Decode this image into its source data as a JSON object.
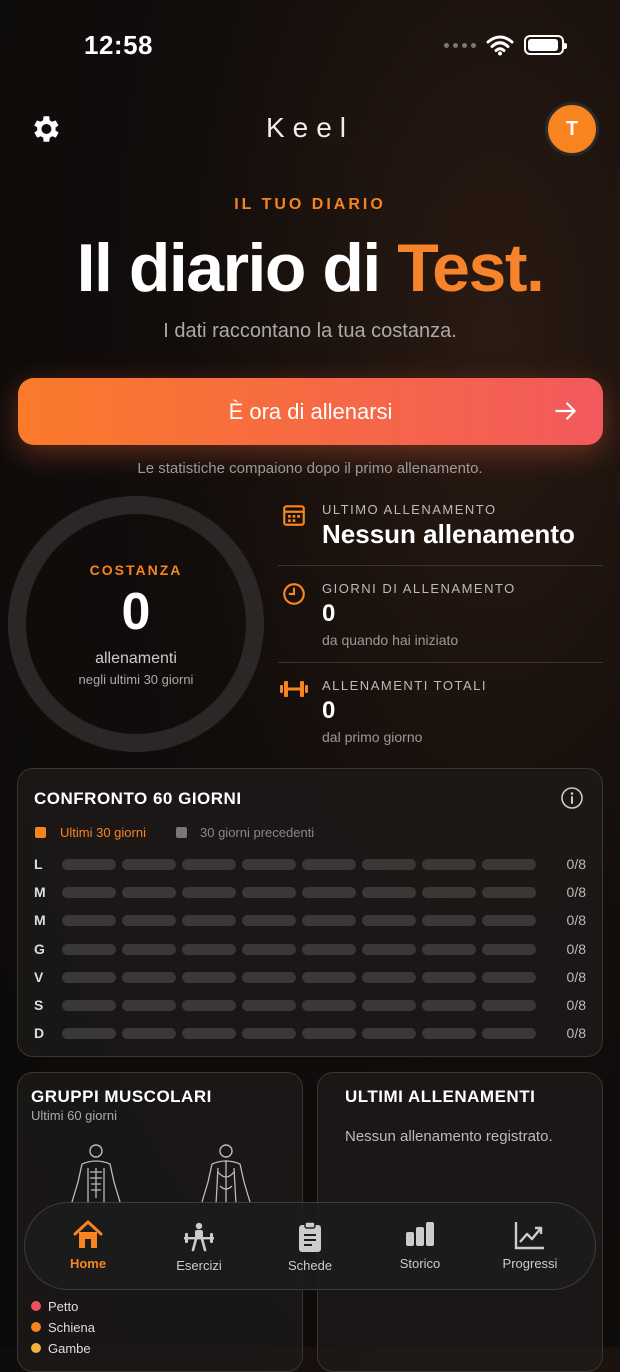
{
  "status": {
    "time": "12:58"
  },
  "header": {
    "brand": "Keel",
    "avatar_initial": "T"
  },
  "hero": {
    "kicker": "IL TUO DIARIO",
    "title_prefix": "Il diario di ",
    "title_accent": "Test.",
    "subtitle": "I dati raccontano la tua costanza."
  },
  "cta": {
    "label": "È ora di allenarsi"
  },
  "note": "Le statistiche compaiono dopo il primo allenamento.",
  "consistency": {
    "label": "COSTANZA",
    "value": "0",
    "unit": "allenamenti",
    "caption": "negli ultimi 30 giorni"
  },
  "stats": [
    {
      "label": "ULTIMO ALLENAMENTO",
      "value": "Nessun allenamento",
      "caption": ""
    },
    {
      "label": "GIORNI DI ALLENAMENTO",
      "value": "0",
      "caption": "da quando hai iniziato"
    },
    {
      "label": "ALLENAMENTI TOTALI",
      "value": "0",
      "caption": "dal primo giorno"
    }
  ],
  "compare": {
    "title": "CONFRONTO 60 GIORNI",
    "legend_current": "Ultimi 30 giorni",
    "legend_previous": "30 giorni precedenti",
    "rows": [
      {
        "day": "L",
        "value": "0/8"
      },
      {
        "day": "M",
        "value": "0/8"
      },
      {
        "day": "M",
        "value": "0/8"
      },
      {
        "day": "G",
        "value": "0/8"
      },
      {
        "day": "V",
        "value": "0/8"
      },
      {
        "day": "S",
        "value": "0/8"
      },
      {
        "day": "D",
        "value": "0/8"
      }
    ]
  },
  "muscles": {
    "title": "GRUPPI MUSCOLARI",
    "subtitle": "Ultimi 60 giorni",
    "groups": [
      {
        "label": "Petto",
        "color": "#ef4f5f"
      },
      {
        "label": "Schiena",
        "color": "#f7841f"
      },
      {
        "label": "Gambe",
        "color": "#f2b13a"
      }
    ]
  },
  "recent": {
    "title": "ULTIMI ALLENAMENTI",
    "empty": "Nessun allenamento registrato."
  },
  "tabs": [
    {
      "label": "Home",
      "icon": "home-icon",
      "active": true
    },
    {
      "label": "Esercizi",
      "icon": "exercise-icon"
    },
    {
      "label": "Schede",
      "icon": "clipboard-icon"
    },
    {
      "label": "Storico",
      "icon": "history-icon"
    },
    {
      "label": "Progressi",
      "icon": "progress-icon"
    }
  ],
  "colors": {
    "accent": "#f7841f",
    "cta_start": "#fb7a2a",
    "cta_end": "#f2595c"
  }
}
